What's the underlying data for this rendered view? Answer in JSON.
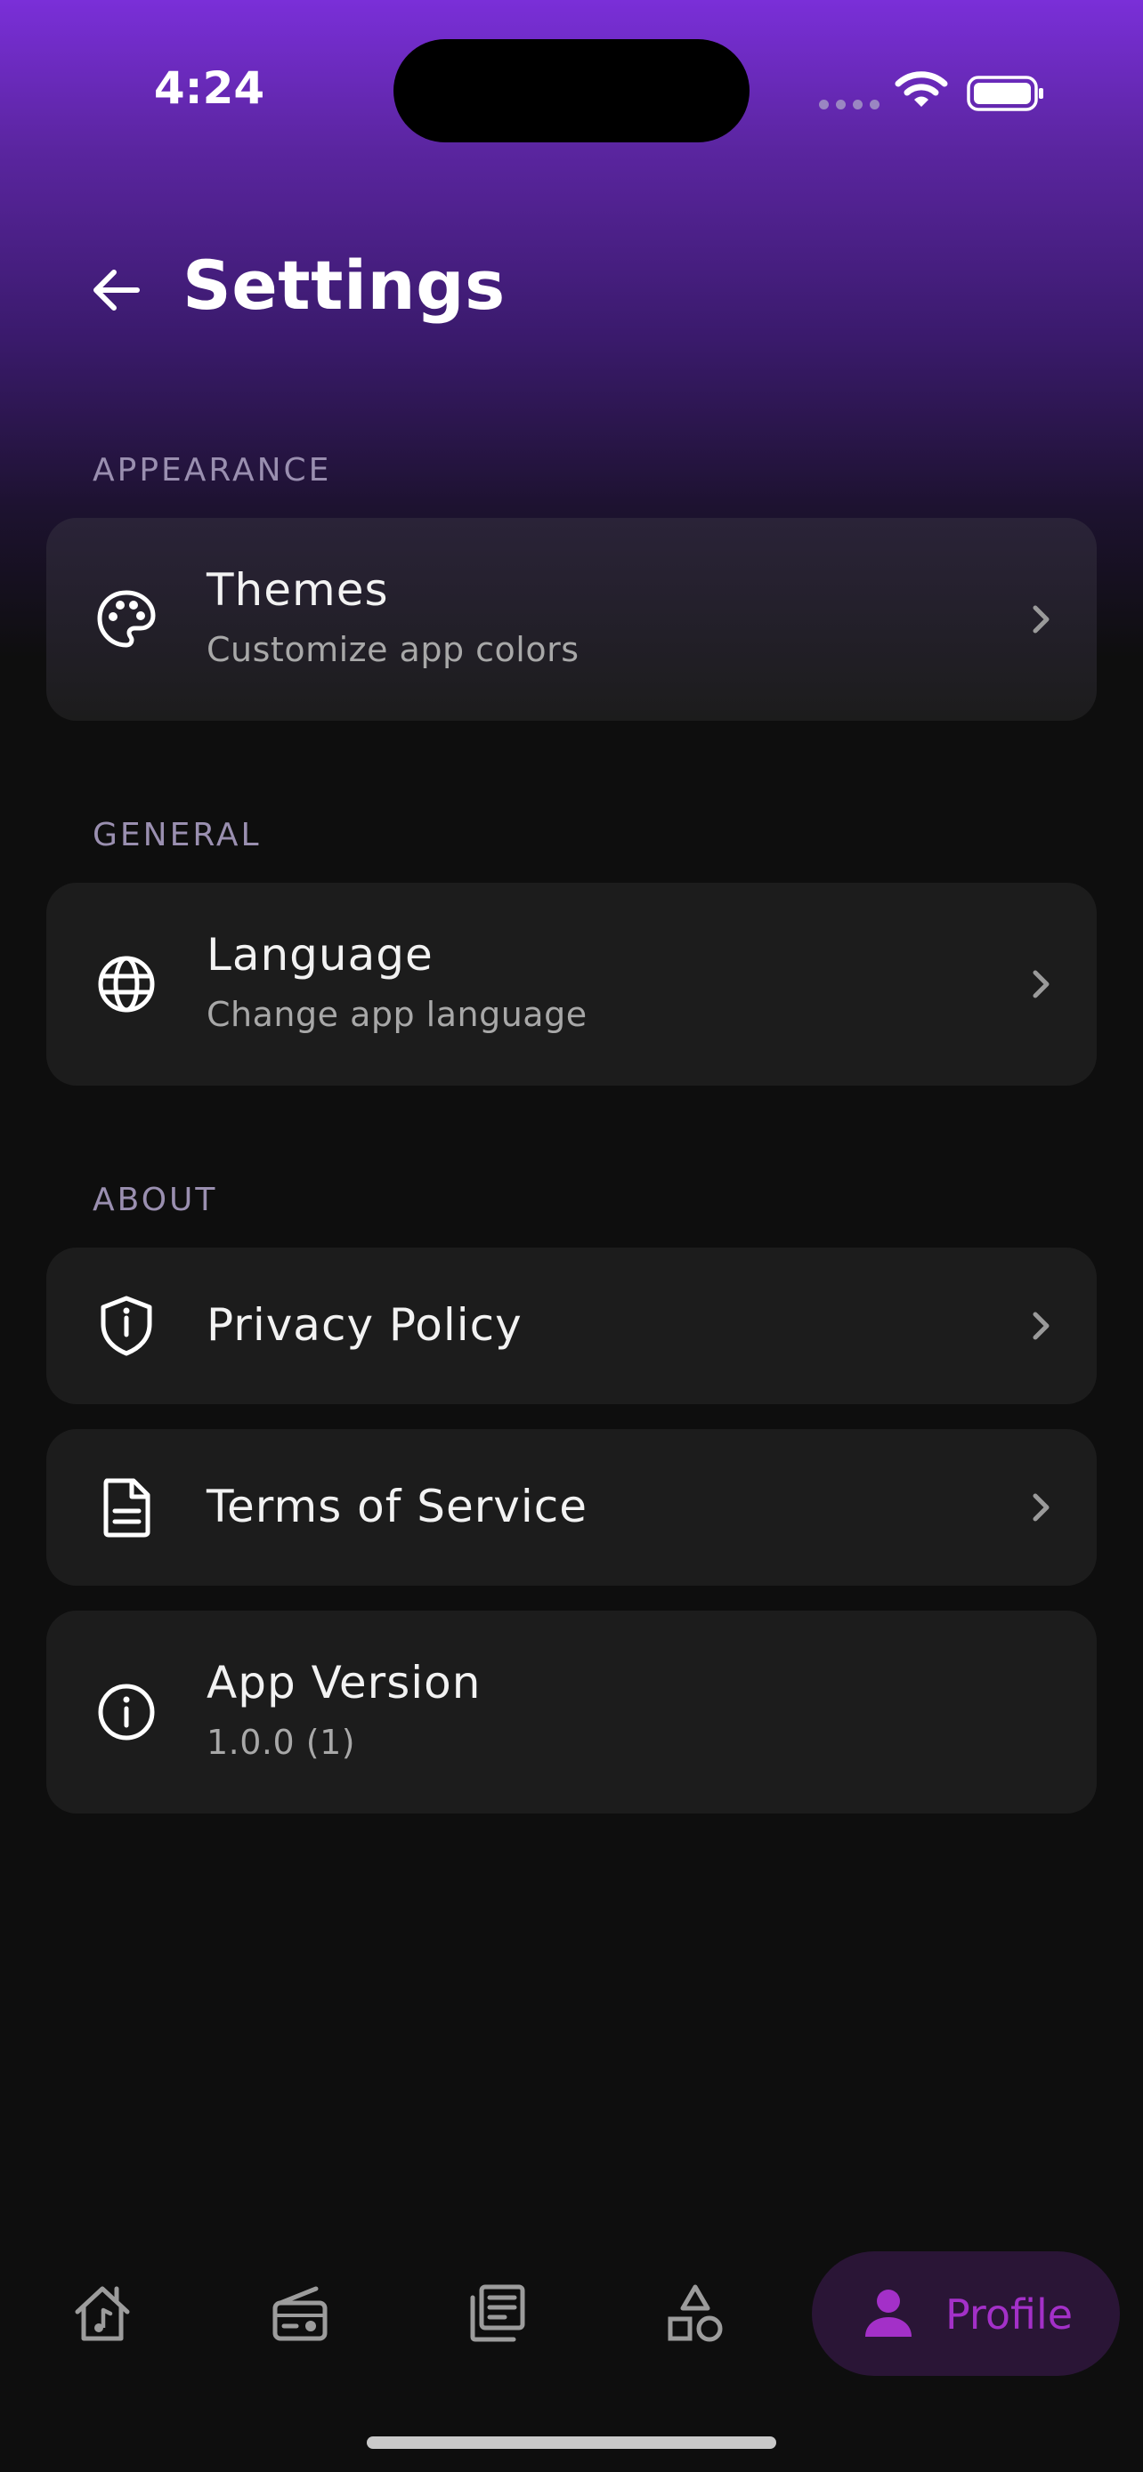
{
  "status_bar": {
    "time": "4:24"
  },
  "header": {
    "title": "Settings"
  },
  "sections": {
    "appearance": {
      "label": "APPEARANCE"
    },
    "general": {
      "label": "GENERAL"
    },
    "about": {
      "label": "ABOUT"
    }
  },
  "items": {
    "themes": {
      "title": "Themes",
      "subtitle": "Customize app colors",
      "icon": "palette-icon"
    },
    "language": {
      "title": "Language",
      "subtitle": "Change app language",
      "icon": "globe-icon"
    },
    "privacy": {
      "title": "Privacy Policy",
      "icon": "shield-icon"
    },
    "terms": {
      "title": "Terms of Service",
      "icon": "document-icon"
    },
    "version": {
      "title": "App Version",
      "subtitle": "1.0.0 (1)",
      "icon": "info-icon"
    }
  },
  "bottom_nav": {
    "items": [
      {
        "icon": "music-home-icon"
      },
      {
        "icon": "radio-icon"
      },
      {
        "icon": "news-icon"
      },
      {
        "icon": "shapes-icon"
      },
      {
        "icon": "person-icon",
        "label": "Profile",
        "active": true
      }
    ]
  },
  "colors": {
    "accent": "#a330c8",
    "gradient_top": "#7a2fd8",
    "background": "#0e0e0e",
    "card": "#1c1c1c"
  }
}
